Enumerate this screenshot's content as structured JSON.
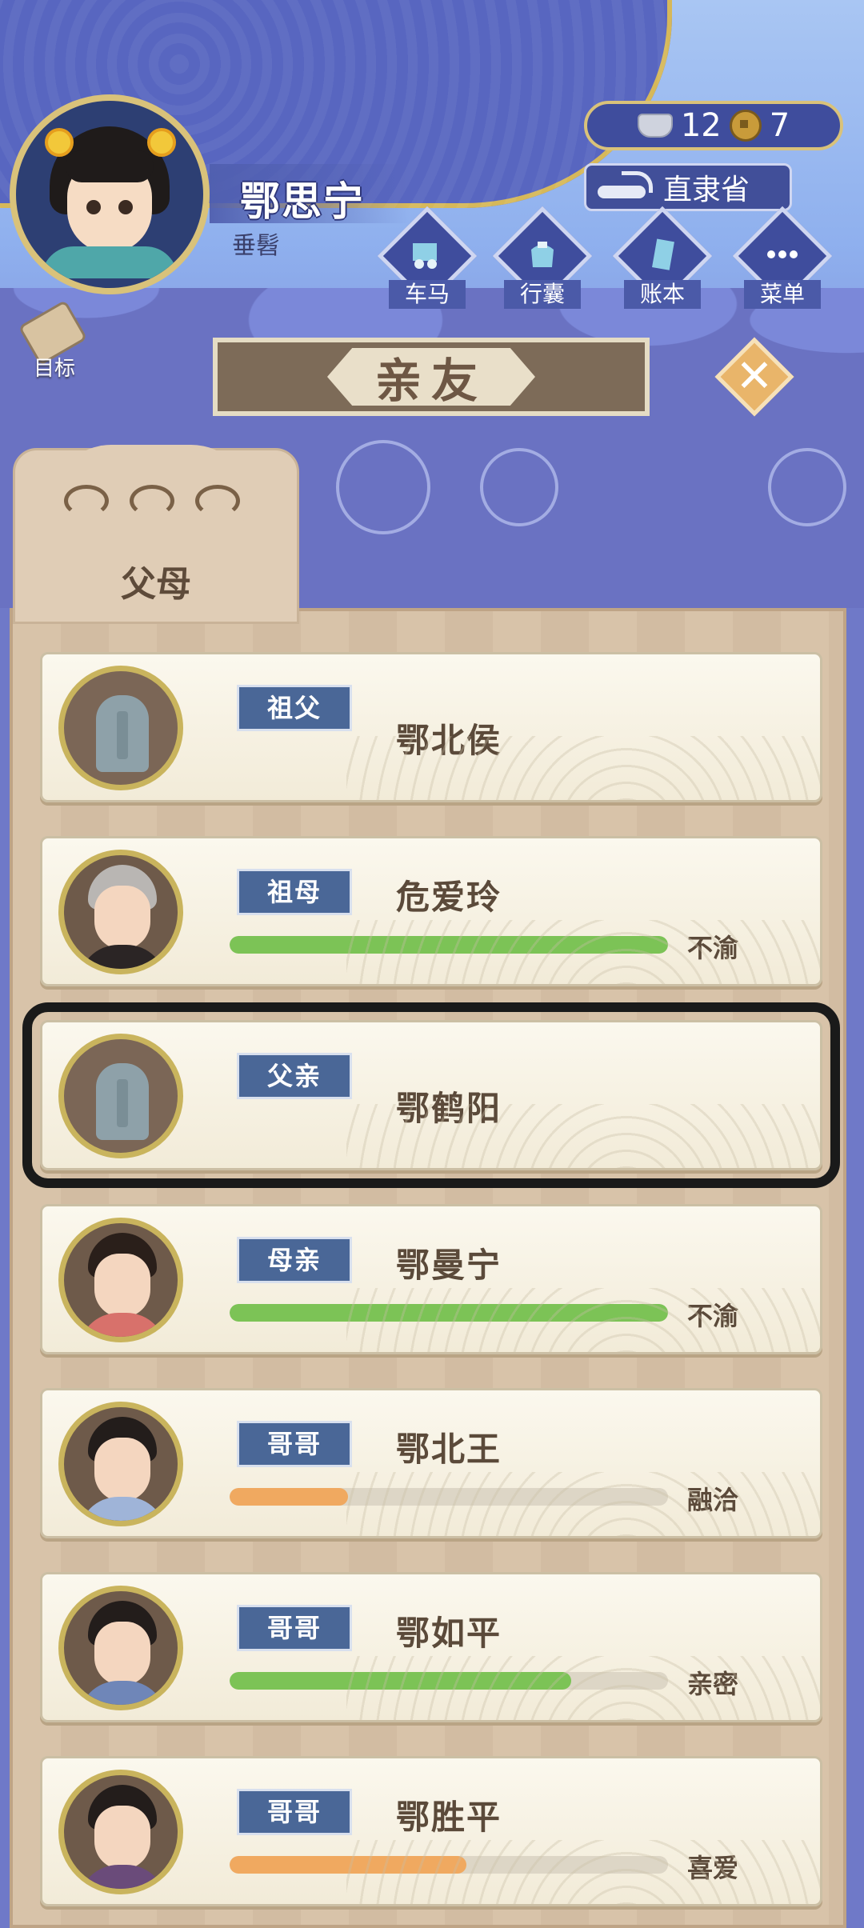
{
  "player": {
    "name": "鄂思宁",
    "title": "垂髫"
  },
  "goal_label": "目标",
  "currency": {
    "silver": "12",
    "coins": "7"
  },
  "province": "直隶省",
  "nav": [
    {
      "label": "车马",
      "icon": "carriage-icon"
    },
    {
      "label": "行囊",
      "icon": "bag-icon"
    },
    {
      "label": "账本",
      "icon": "ledger-icon"
    },
    {
      "label": "菜单",
      "icon": "menu-dots-icon"
    }
  ],
  "screen_title": "亲友",
  "tab_label": "父母",
  "colors": {
    "green": "#7cc356",
    "orange": "#f0a960",
    "badge": "#4a6797"
  },
  "relatives": [
    {
      "role": "祖父",
      "name": "鄂北侯",
      "deceased": true
    },
    {
      "role": "祖母",
      "name": "危爱玲",
      "status": "不渝",
      "progress": 1.0,
      "bar_color": "#7cc356",
      "hair": "#b9b6b3",
      "robe": "#2b2525"
    },
    {
      "role": "父亲",
      "name": "鄂鹤阳",
      "deceased": true,
      "highlight": true
    },
    {
      "role": "母亲",
      "name": "鄂曼宁",
      "status": "不渝",
      "progress": 1.0,
      "bar_color": "#7cc356",
      "hair": "#2a1f1a",
      "robe": "#d8716b"
    },
    {
      "role": "哥哥",
      "name": "鄂北王",
      "status": "融洽",
      "progress": 0.27,
      "bar_color": "#f0a960",
      "hair": "#231d1b",
      "robe": "#9fb4d8"
    },
    {
      "role": "哥哥",
      "name": "鄂如平",
      "status": "亲密",
      "progress": 0.78,
      "bar_color": "#7cc356",
      "hair": "#231d1b",
      "robe": "#6f86b8"
    },
    {
      "role": "哥哥",
      "name": "鄂胜平",
      "status": "喜爱",
      "progress": 0.54,
      "bar_color": "#f0a960",
      "hair": "#231d1b",
      "robe": "#6a4b7a"
    }
  ]
}
